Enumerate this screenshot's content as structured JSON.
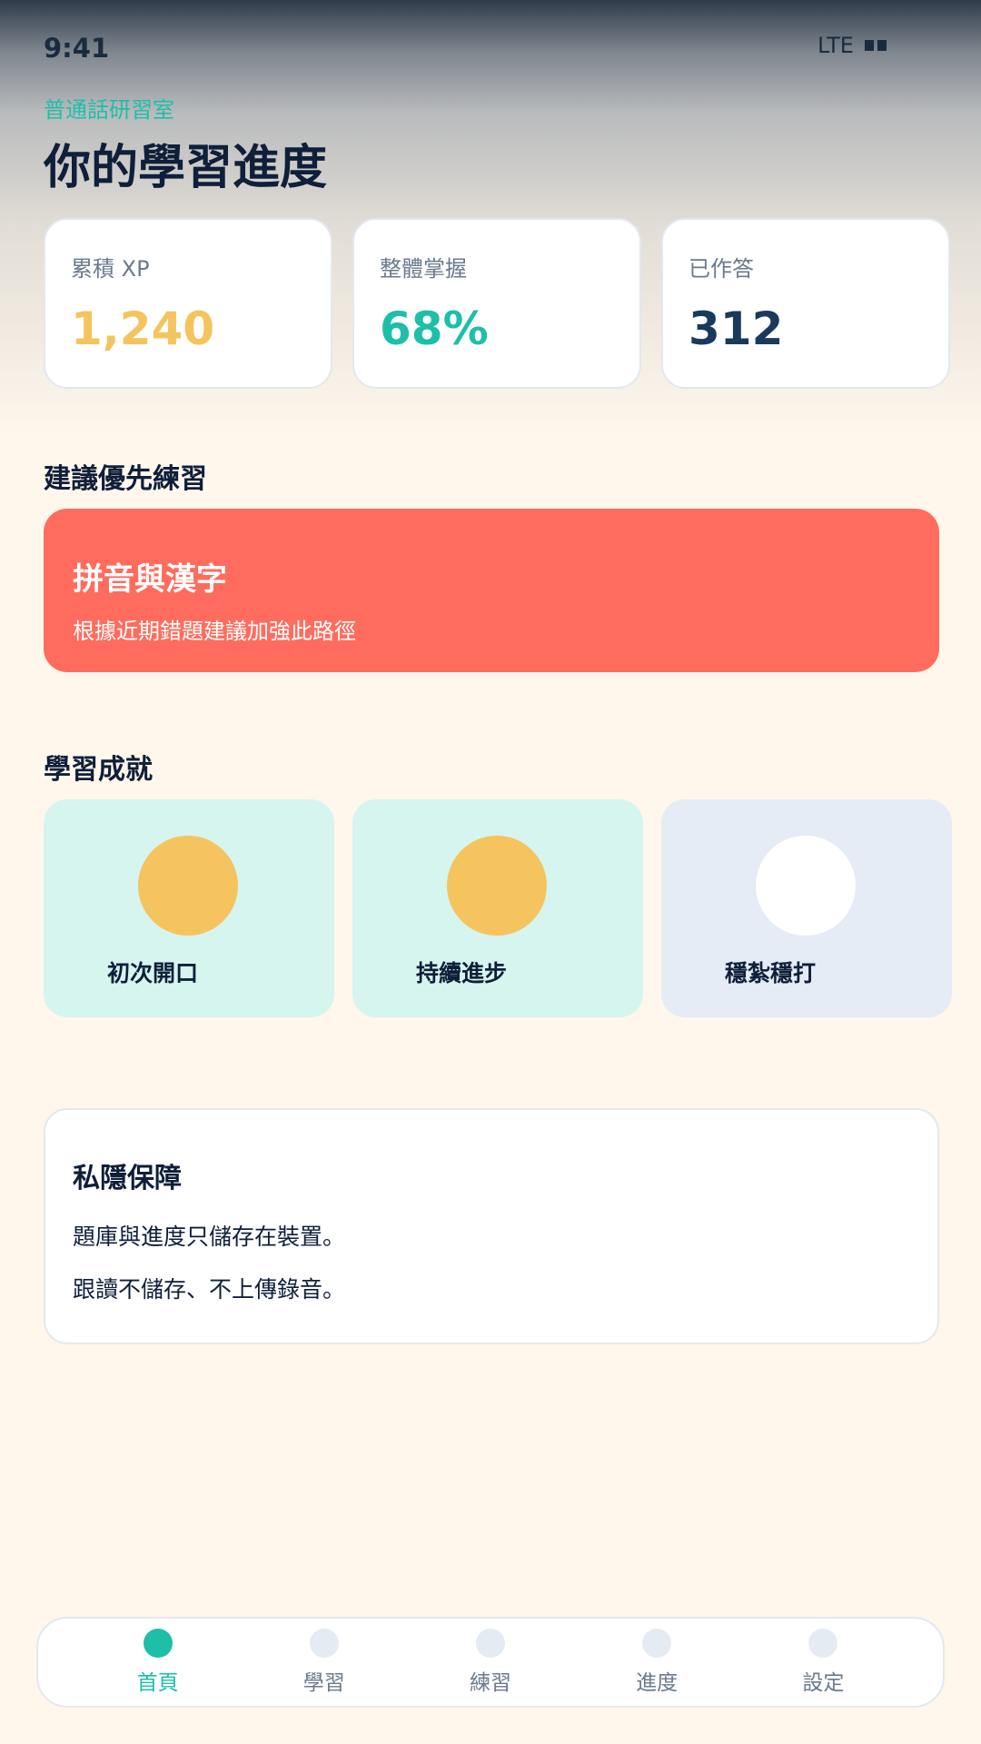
{
  "status_bar": {
    "time": "9:41",
    "network": "LTE"
  },
  "header": {
    "app_label": "普通話研習室",
    "title": "你的學習進度"
  },
  "stats": [
    {
      "label": "累積 XP",
      "value": "1,240",
      "color": "#F5C45E"
    },
    {
      "label": "整體掌握",
      "value": "68%",
      "color": "#1DBFA9"
    },
    {
      "label": "已作答",
      "value": "312",
      "color": "#1A3A5C"
    }
  ],
  "priority": {
    "section_title": "建議優先練習",
    "card_title": "拼音與漢字",
    "card_desc": "根據近期錯題建議加強此路徑",
    "color": "#FF6C5E"
  },
  "achievements": {
    "section_title": "學習成就",
    "items": [
      {
        "label": "初次開口",
        "unlocked": true
      },
      {
        "label": "持續進步",
        "unlocked": true
      },
      {
        "label": "穩紮穩打",
        "unlocked": false
      }
    ],
    "colors": {
      "unlocked_bg": "#D6F5EF",
      "locked_bg": "#E6ECF5",
      "unlocked_badge": "#F5C45E",
      "locked_badge": "#FFFFFF"
    }
  },
  "privacy": {
    "title": "私隱保障",
    "lines": [
      "題庫與進度只儲存在裝置。",
      "跟讀不儲存、不上傳錄音。"
    ]
  },
  "nav": {
    "items": [
      {
        "label": "首頁",
        "active": true
      },
      {
        "label": "學習",
        "active": false
      },
      {
        "label": "練習",
        "active": false
      },
      {
        "label": "進度",
        "active": false
      },
      {
        "label": "設定",
        "active": false
      }
    ],
    "accent_color": "#1DBFA9"
  }
}
